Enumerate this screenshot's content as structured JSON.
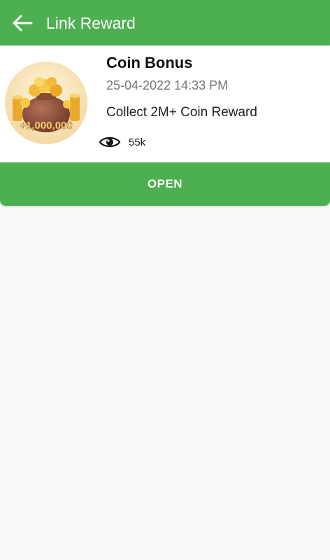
{
  "colors": {
    "primary": "#4caf50",
    "background": "#f9f9f9",
    "card": "#ffffff"
  },
  "appbar": {
    "title": "Link Reward",
    "back_icon": "arrow-left-icon"
  },
  "reward_card": {
    "title": "Coin Bonus",
    "date": "25-04-2022 14:33 PM",
    "description": "Collect 2M+ Coin Reward",
    "views_icon": "eye-icon",
    "views": "55k",
    "thumbnail_text": "+1,000,000",
    "open_label": "OPEN"
  }
}
